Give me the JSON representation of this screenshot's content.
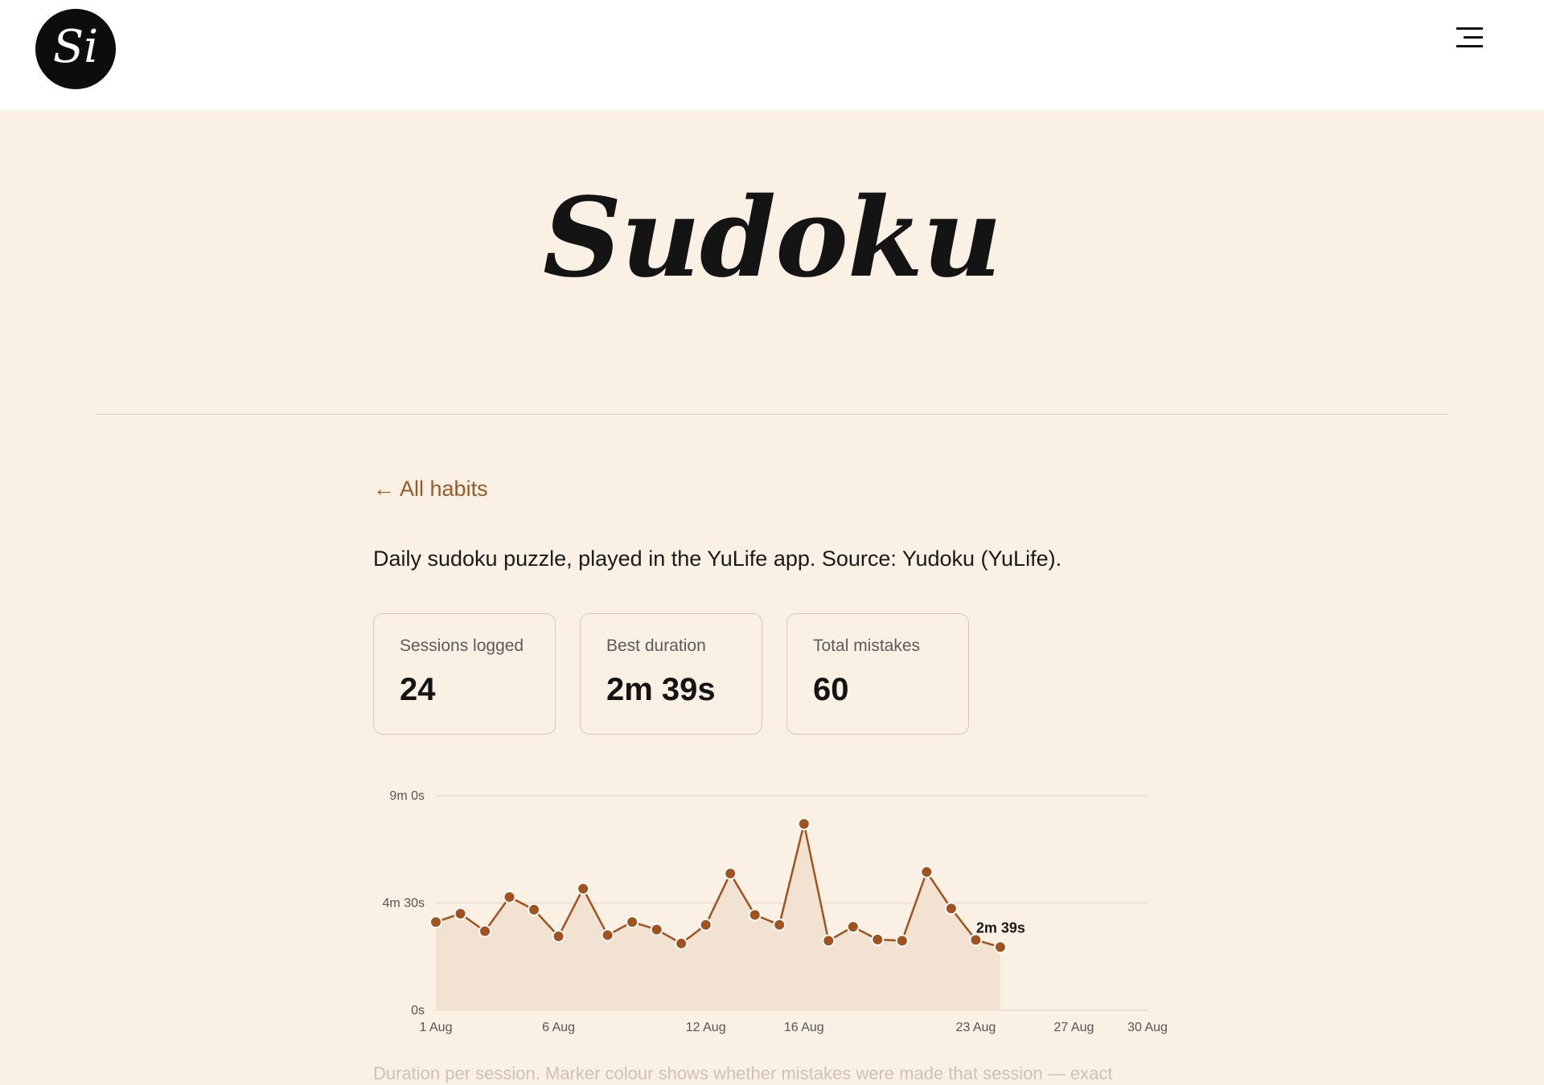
{
  "header": {
    "logo_text": "Si",
    "logo_icon": "monogram-logo-icon",
    "menu_icon": "hamburger-menu-icon"
  },
  "page": {
    "title": "Sudoku",
    "back_link": "← All habits",
    "description": "Daily sudoku puzzle, played in the YuLife app. Source: Yudoku (YuLife)."
  },
  "stats": [
    {
      "label": "Sessions logged",
      "value": "24"
    },
    {
      "label": "Best duration",
      "value": "2m 39s"
    },
    {
      "label": "Total mistakes",
      "value": "60"
    }
  ],
  "chart_data": {
    "type": "area",
    "title": "",
    "xlabel": "",
    "ylabel": "",
    "y_unit": "seconds",
    "ylim": [
      0,
      540
    ],
    "y_ticks": [
      0,
      270,
      540
    ],
    "y_tick_labels": [
      "0s",
      "4m 30s",
      "9m 0s"
    ],
    "x_ticks": [
      "2024-08-01",
      "2024-08-06",
      "2024-08-12",
      "2024-08-16",
      "2024-08-23",
      "2024-08-27",
      "2024-08-30"
    ],
    "x_tick_labels": [
      "1 Aug",
      "6 Aug",
      "12 Aug",
      "16 Aug",
      "23 Aug",
      "27 Aug",
      "30 Aug"
    ],
    "grid": "horizontal",
    "colors": {
      "line": "#a0521f",
      "fill": "#f2e2d2",
      "marker": "#a0521f",
      "marker_stroke": "#ffffff",
      "grid": "#e5dbcf",
      "axis_text": "#555555"
    },
    "points": [
      {
        "x": "2024-08-01",
        "y": 222
      },
      {
        "x": "2024-08-02",
        "y": 243
      },
      {
        "x": "2024-08-03",
        "y": 199
      },
      {
        "x": "2024-08-04",
        "y": 285
      },
      {
        "x": "2024-08-05",
        "y": 253
      },
      {
        "x": "2024-08-06",
        "y": 186
      },
      {
        "x": "2024-08-07",
        "y": 306
      },
      {
        "x": "2024-08-08",
        "y": 189
      },
      {
        "x": "2024-08-09",
        "y": 222
      },
      {
        "x": "2024-08-10",
        "y": 203
      },
      {
        "x": "2024-08-11",
        "y": 168
      },
      {
        "x": "2024-08-12",
        "y": 215
      },
      {
        "x": "2024-08-13",
        "y": 344
      },
      {
        "x": "2024-08-14",
        "y": 240
      },
      {
        "x": "2024-08-15",
        "y": 215
      },
      {
        "x": "2024-08-16",
        "y": 469
      },
      {
        "x": "2024-08-17",
        "y": 175
      },
      {
        "x": "2024-08-18",
        "y": 210
      },
      {
        "x": "2024-08-19",
        "y": 178
      },
      {
        "x": "2024-08-20",
        "y": 175
      },
      {
        "x": "2024-08-21",
        "y": 348
      },
      {
        "x": "2024-08-22",
        "y": 256
      },
      {
        "x": "2024-08-23",
        "y": 177
      },
      {
        "x": "2024-08-24",
        "y": 159
      }
    ],
    "last_label": "2m 39s"
  },
  "caption": "Duration per session. Marker colour shows whether mistakes were made that session — exact"
}
